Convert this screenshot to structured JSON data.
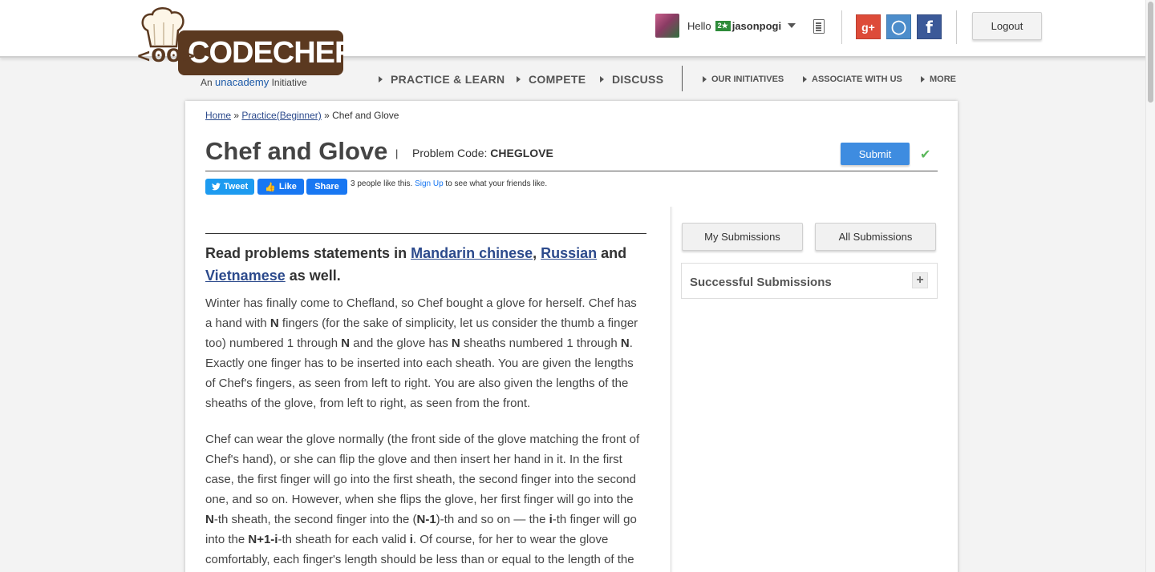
{
  "logo": {
    "brand": "CODECHEF",
    "face": "<ʘʘ>",
    "initiative_prefix": "An",
    "initiative_brand": "unacademy",
    "initiative_suffix": "Initiative"
  },
  "user": {
    "greeting": "Hello",
    "stars": "2★",
    "username": "jasonpogi"
  },
  "header": {
    "logout_label": "Logout",
    "social": {
      "gplus": "g+",
      "github": "◯",
      "facebook": "f"
    }
  },
  "nav": {
    "main": [
      "PRACTICE & LEARN",
      "COMPETE",
      "DISCUSS"
    ],
    "secondary": [
      "OUR INITIATIVES",
      "ASSOCIATE WITH US",
      "MORE"
    ]
  },
  "breadcrumb": {
    "home": "Home",
    "sep1": " » ",
    "practice": "Practice(Beginner)",
    "sep2": " » ",
    "current": "Chef and Glove"
  },
  "problem": {
    "title": "Chef and Glove",
    "pipe": "|",
    "code_label": "Problem Code: ",
    "code": "CHEGLOVE",
    "submit_label": "Submit",
    "check": "✔"
  },
  "share": {
    "tweet": "Tweet",
    "like": "Like",
    "share": "Share",
    "likes_text": "3 people like this. ",
    "signup": "Sign Up",
    "likes_suffix": " to see what your friends like."
  },
  "statement": {
    "lang_prefix": "Read problems statements in ",
    "lang1": "Mandarin chinese",
    "lang_comma": ", ",
    "lang2": "Russian",
    "lang_and": " and ",
    "lang3": "Vietnamese",
    "lang_suffix": " as well.",
    "para1": [
      {
        "t": "Winter has finally come to Chefland, so Chef bought a glove for herself. Chef has a hand with "
      },
      {
        "t": "N",
        "b": true
      },
      {
        "t": " fingers (for the sake of simplicity, let us consider the thumb a finger too) numbered 1 through "
      },
      {
        "t": "N",
        "b": true
      },
      {
        "t": " and the glove has "
      },
      {
        "t": "N",
        "b": true
      },
      {
        "t": " sheaths numbered 1 through "
      },
      {
        "t": "N",
        "b": true
      },
      {
        "t": ". Exactly one finger has to be inserted into each sheath. You are given the lengths of Chef's fingers, as seen from left to right. You are also given the lengths of the sheaths of the glove, from left to right, as seen from the front."
      }
    ],
    "para2": [
      {
        "t": "Chef can wear the glove normally (the front side of the glove matching the front of Chef's hand), or she can flip the glove and then insert her hand in it. In the first case, the first finger will go into the first sheath, the second finger into the second one, and so on. However, when she flips the glove, her first finger will go into the "
      },
      {
        "t": "N",
        "b": true
      },
      {
        "t": "-th sheath, the second finger into the ("
      },
      {
        "t": "N-1",
        "b": true
      },
      {
        "t": ")-th and so on — the "
      },
      {
        "t": "i",
        "b": true
      },
      {
        "t": "-th finger will go into the "
      },
      {
        "t": "N+1-i",
        "b": true
      },
      {
        "t": "-th sheath for each valid "
      },
      {
        "t": "i",
        "b": true
      },
      {
        "t": ". Of course, for her to wear the glove comfortably, each finger's length should be less than or equal to the length of the"
      }
    ]
  },
  "sidebar": {
    "my_submissions": "My Submissions",
    "all_submissions": "All Submissions",
    "successful_title": "Successful Submissions",
    "expand": "+"
  },
  "colors": {
    "brand_brown": "#5b3920",
    "submit_blue": "#3e8ce0",
    "link_blue": "#2c4a8c",
    "check_green": "#5cb85c"
  }
}
